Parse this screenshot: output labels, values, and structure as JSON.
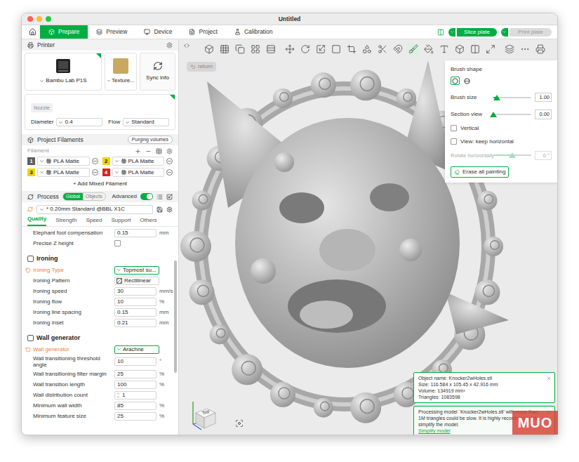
{
  "window": {
    "title": "Untitled"
  },
  "top_tabs": [
    {
      "label": "Prepare",
      "selected": true
    },
    {
      "label": "Preview",
      "selected": false
    },
    {
      "label": "Device",
      "selected": false
    },
    {
      "label": "Project",
      "selected": false
    },
    {
      "label": "Calibration",
      "selected": false
    }
  ],
  "slice_button": {
    "label": "Slice plate",
    "disabled": false
  },
  "print_button": {
    "label": "Print plate",
    "disabled": true
  },
  "printer": {
    "section": "Printer",
    "name": "Bambu Lab P1S",
    "plate": "Texture...",
    "sync": "Sync info",
    "nozzle_label": "Nozzle",
    "diameter_label": "Diameter",
    "diameter": "0.4",
    "flow_label": "Flow",
    "flow": "Standard"
  },
  "filaments": {
    "section": "Project Filaments",
    "purging": "Purging volumes",
    "label": "Filament",
    "items": [
      {
        "index": "1",
        "name": "PLA Matte",
        "color": "#5e5e5e"
      },
      {
        "index": "2",
        "name": "PLA Matte",
        "color": "#f3d400"
      },
      {
        "index": "3",
        "name": "PLA Matte",
        "color": "#f3d400"
      },
      {
        "index": "4",
        "name": "PLA Matte",
        "color": "#e0201c"
      }
    ],
    "add": "+ Add Mixed Filament"
  },
  "process": {
    "section": "Process",
    "scopes": [
      {
        "label": "Global",
        "selected": true
      },
      {
        "label": "Objects",
        "selected": false
      }
    ],
    "advanced": {
      "label": "Advanced",
      "on": true
    },
    "preset": "* 0.20mm Standard @BBL X1C",
    "tabs": [
      {
        "label": "Quality",
        "selected": true
      },
      {
        "label": "Strength",
        "selected": false
      },
      {
        "label": "Speed",
        "selected": false
      },
      {
        "label": "Support",
        "selected": false
      },
      {
        "label": "Others",
        "selected": false
      }
    ],
    "settings": [
      {
        "kind": "number",
        "label": "Elephant foot compensation",
        "value": "0.15",
        "unit": "mm",
        "modified": false
      },
      {
        "kind": "checkbox",
        "label": "Precise Z height",
        "checked": false,
        "modified": false
      },
      {
        "kind": "header",
        "label": "Ironing"
      },
      {
        "kind": "select",
        "label": "Ironing Type",
        "value": "Topmost su...",
        "modified": true
      },
      {
        "kind": "pattern",
        "label": "Ironing Pattern",
        "value": "Rectilinear",
        "modified": false
      },
      {
        "kind": "number",
        "label": "Ironing speed",
        "value": "30",
        "unit": "mm/s",
        "modified": false
      },
      {
        "kind": "number",
        "label": "Ironing flow",
        "value": "10",
        "unit": "%",
        "modified": false
      },
      {
        "kind": "number",
        "label": "Ironing line spacing",
        "value": "0.15",
        "unit": "mm",
        "modified": false
      },
      {
        "kind": "number",
        "label": "Ironing inset",
        "value": "0.21",
        "unit": "mm",
        "modified": false
      },
      {
        "kind": "header",
        "label": "Wall generator"
      },
      {
        "kind": "select",
        "label": "Wall generator",
        "value": "Arachne",
        "modified": true
      },
      {
        "kind": "number",
        "label": "Wall transitioning threshold angle",
        "value": "10",
        "unit": "°",
        "modified": false
      },
      {
        "kind": "number",
        "label": "Wall transitioning filter margin",
        "value": "25",
        "unit": "%",
        "modified": false
      },
      {
        "kind": "number",
        "label": "Wall transition length",
        "value": "100",
        "unit": "%",
        "modified": false
      },
      {
        "kind": "spin",
        "label": "Wall distribution count",
        "value": "1",
        "modified": false
      },
      {
        "kind": "number",
        "label": "Minimum wall width",
        "value": "85",
        "unit": "%",
        "modified": false
      },
      {
        "kind": "number",
        "label": "Minimum feature size",
        "value": "25",
        "unit": "%",
        "modified": false
      }
    ]
  },
  "viewport": {
    "return": "return",
    "nav_cube": "Top"
  },
  "brush_panel": {
    "shape_label": "Brush shape",
    "shapes": [
      {
        "kind": "circle",
        "selected": true
      },
      {
        "kind": "sphere",
        "selected": false
      }
    ],
    "sliders": [
      {
        "label": "Brush size",
        "level": 0.1,
        "reading": "1.00",
        "disabled": false
      },
      {
        "label": "Section view",
        "level": 0,
        "reading": "0.00",
        "disabled": false
      }
    ],
    "checkboxes": [
      {
        "label": "Vertical",
        "checked": false
      },
      {
        "label": "View: keep horizontal",
        "checked": false
      }
    ],
    "rotate": {
      "label": "Rotate horizontally",
      "level": 0.5,
      "reading": "0 °",
      "disabled": true
    },
    "erase": "Erase all painting"
  },
  "notifications": {
    "info": [
      "Object name: Knocker2wHoles.stl",
      "Size: 116.584 x 105.45 x 42.916 mm",
      "Volume: 134919 mm³",
      "Triangles: 1083598"
    ],
    "warning": "Processing model `Knocker2wHoles.stl' with more than 1M triangles could be slow. It is highly recommended to simplify the model.",
    "link": "Simplify model"
  },
  "watermark": "MUO"
}
